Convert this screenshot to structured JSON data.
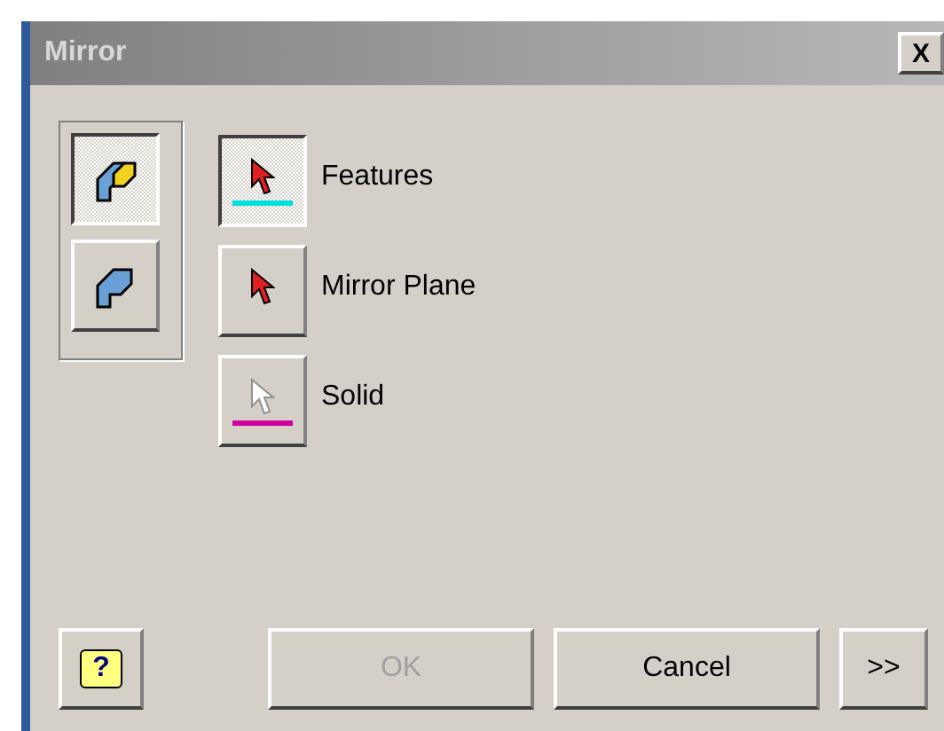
{
  "window": {
    "title": "Mirror",
    "close": "X"
  },
  "modes": [
    {
      "kind": "features",
      "selected": true
    },
    {
      "kind": "solid",
      "selected": false
    }
  ],
  "selectors": [
    {
      "label": "Features",
      "selected": true,
      "active": true,
      "color": "#00e0e0"
    },
    {
      "label": "Mirror Plane",
      "selected": false,
      "active": true
    },
    {
      "label": "Solid",
      "selected": false,
      "active": false,
      "color": "#d000a0"
    }
  ],
  "help": {
    "label": "?"
  },
  "buttons": [
    {
      "label": "OK",
      "disabled": true
    },
    {
      "label": "Cancel",
      "disabled": false
    },
    {
      "label": ">>",
      "disabled": false
    }
  ]
}
